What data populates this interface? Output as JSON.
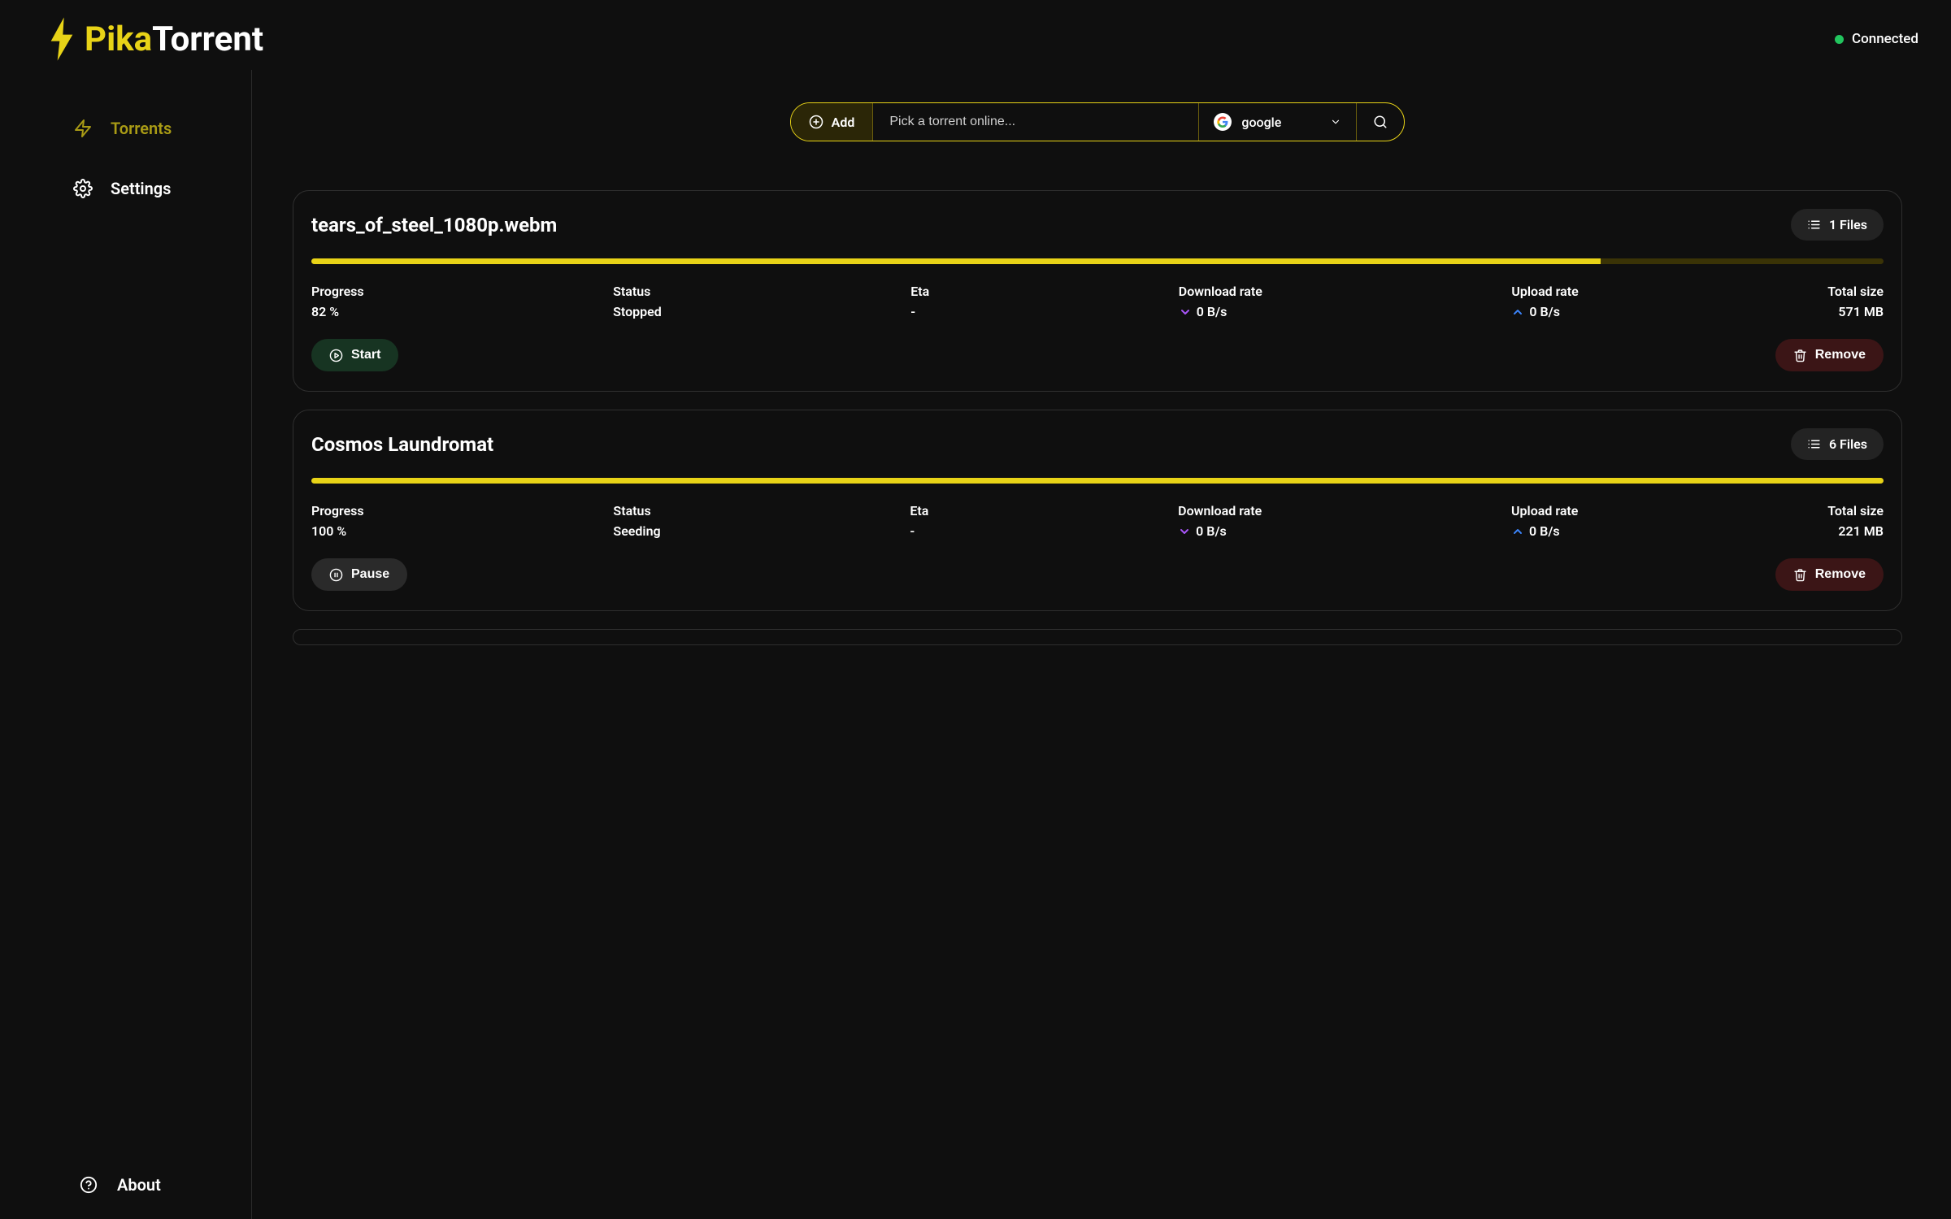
{
  "app": {
    "name_part1": "Pika",
    "name_part2": "Torrent"
  },
  "connection": {
    "status": "Connected"
  },
  "sidebar": {
    "torrents": "Torrents",
    "settings": "Settings",
    "about": "About"
  },
  "toolbar": {
    "add_label": "Add",
    "search_placeholder": "Pick a torrent online...",
    "provider": "google"
  },
  "labels": {
    "progress": "Progress",
    "status": "Status",
    "eta": "Eta",
    "download_rate": "Download rate",
    "upload_rate": "Upload rate",
    "total_size": "Total size",
    "start": "Start",
    "pause": "Pause",
    "remove": "Remove"
  },
  "torrents": [
    {
      "name": "tears_of_steel_1080p.webm",
      "files_label": "1 Files",
      "progress_pct": 82,
      "progress_text": "82 %",
      "status": "Stopped",
      "eta": "-",
      "download_rate": "0 B/s",
      "upload_rate": "0 B/s",
      "total_size": "571 MB",
      "action": "start"
    },
    {
      "name": "Cosmos Laundromat",
      "files_label": "6 Files",
      "progress_pct": 100,
      "progress_text": "100 %",
      "status": "Seeding",
      "eta": "-",
      "download_rate": "0 B/s",
      "upload_rate": "0 B/s",
      "total_size": "221 MB",
      "action": "pause"
    }
  ]
}
